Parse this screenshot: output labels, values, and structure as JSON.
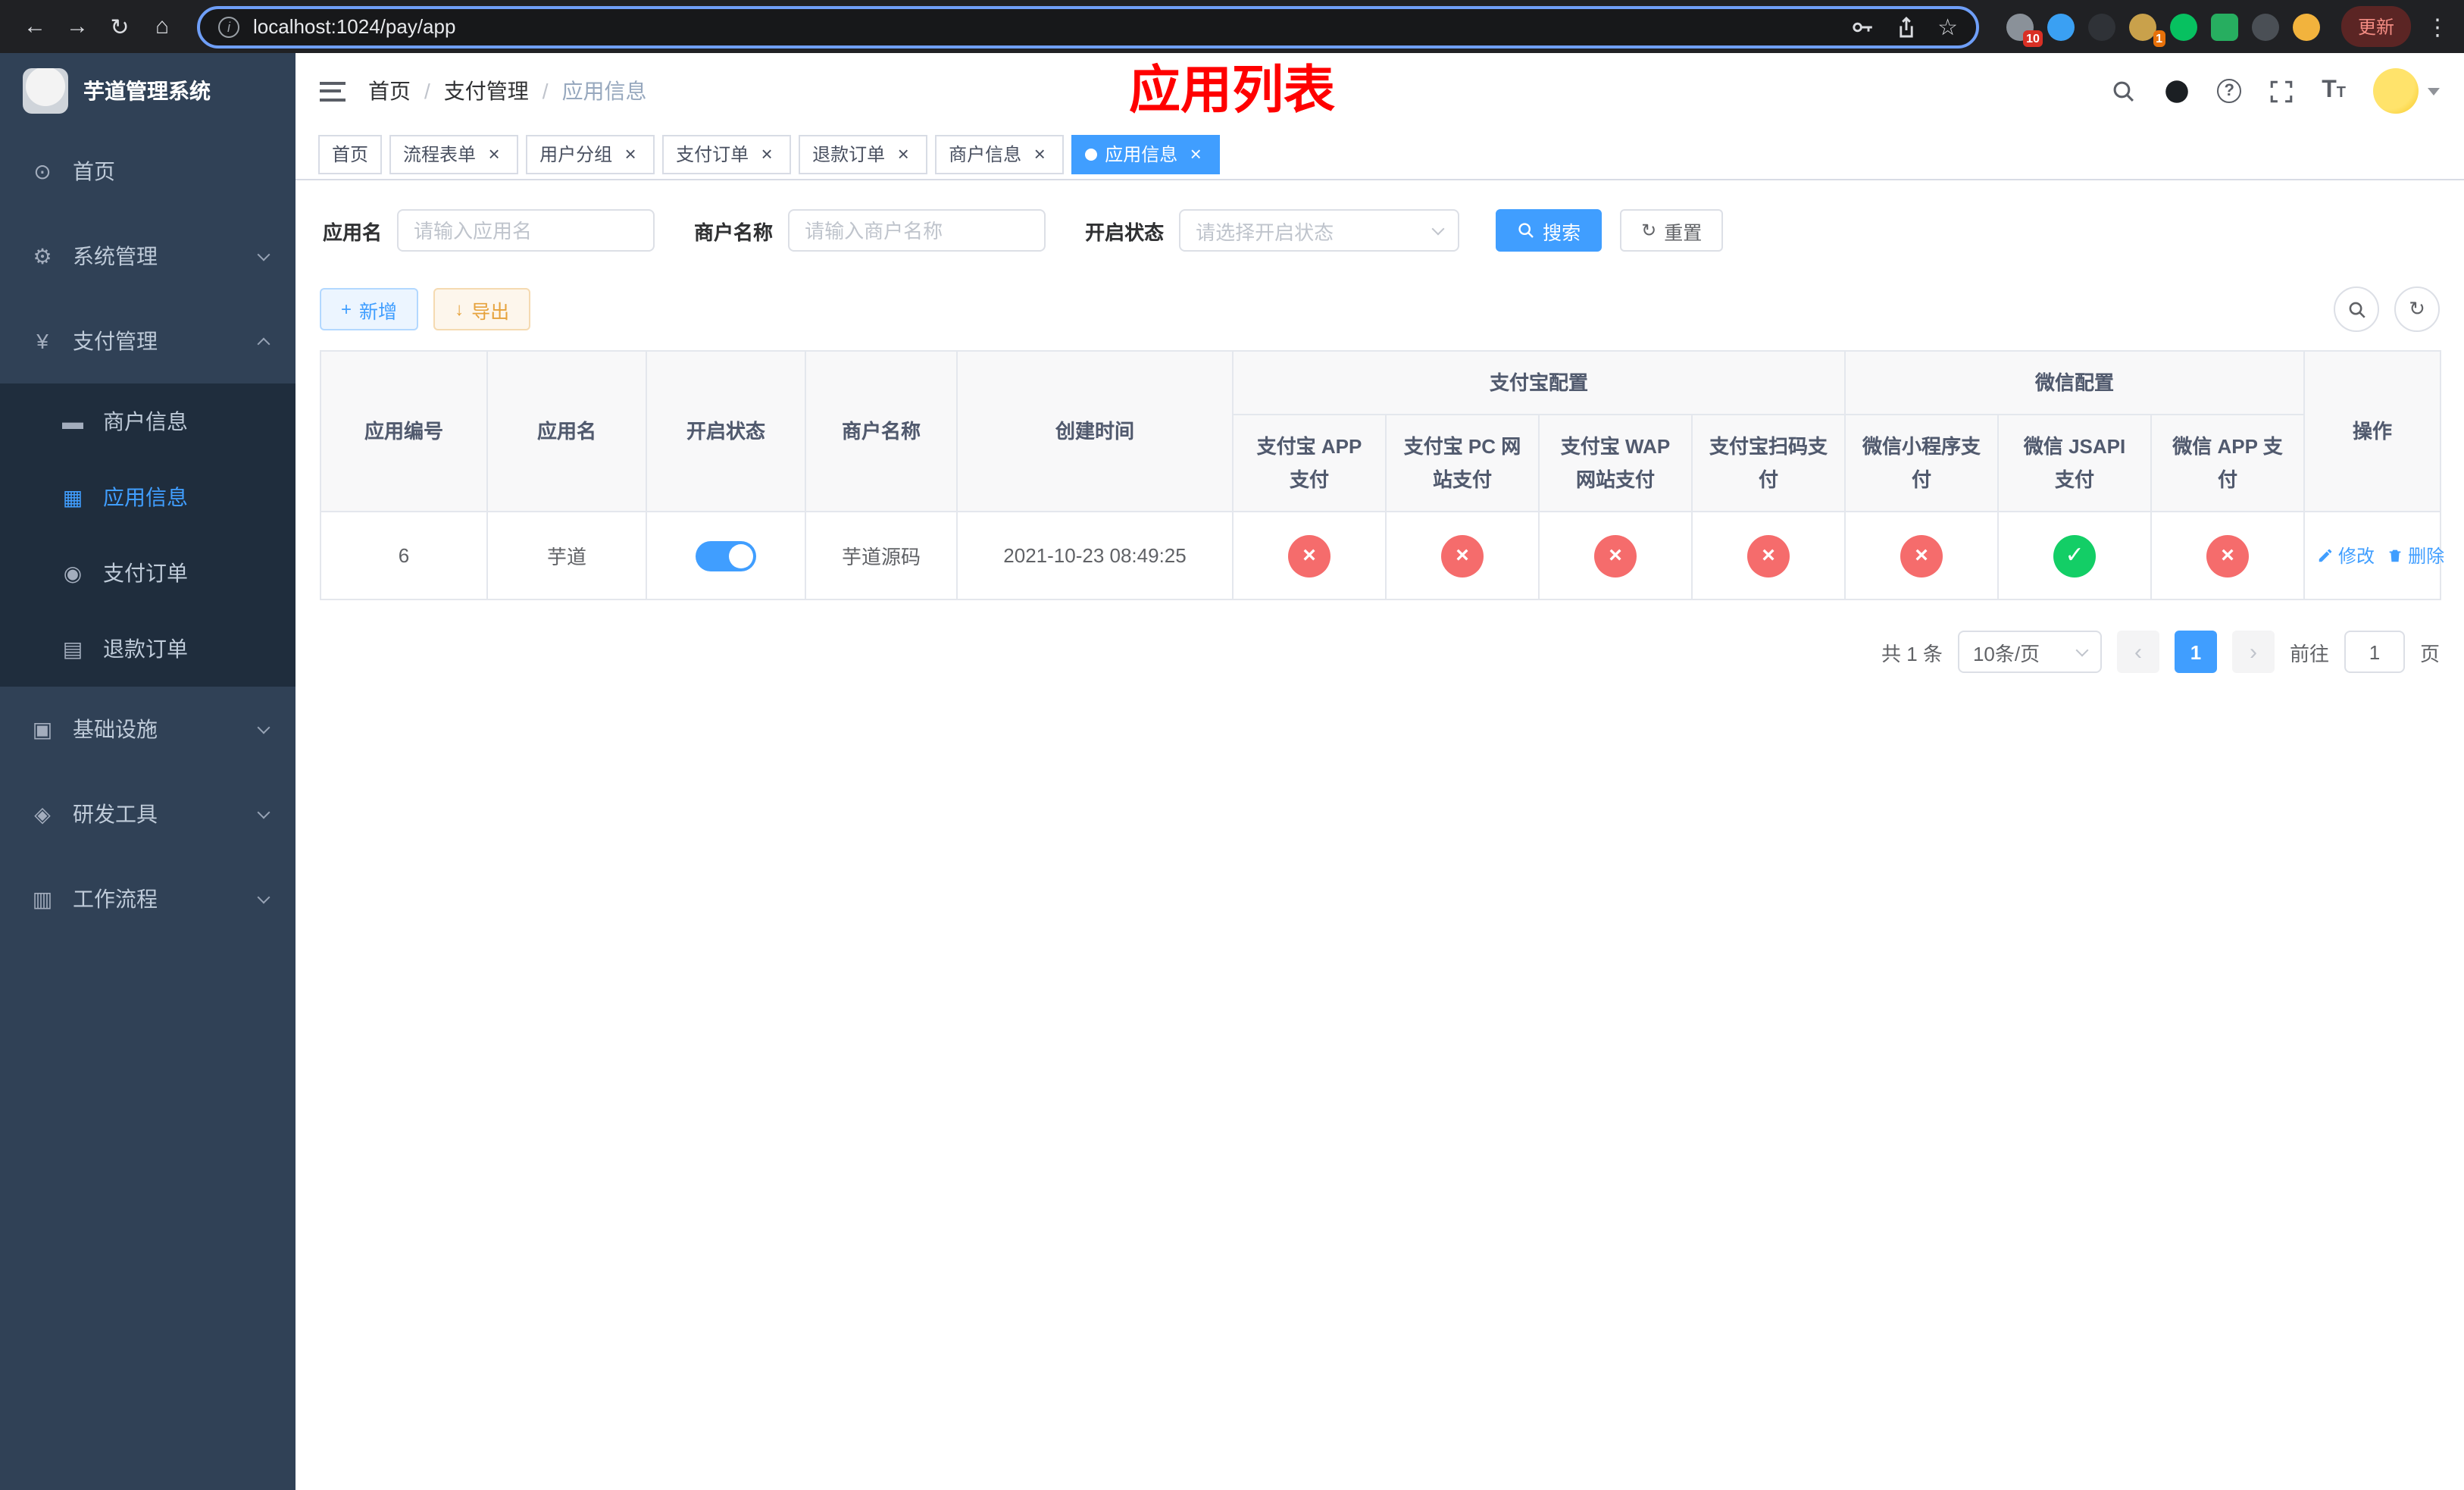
{
  "browser": {
    "url": "localhost:1024/pay/app",
    "update_label": "更新",
    "extensions": [
      {
        "name": "extension-icon-1",
        "color": "#8a9199",
        "badge": "10",
        "badge_color": "#d93025",
        "shape": "circle"
      },
      {
        "name": "extension-icon-2",
        "color": "#3aa0f3",
        "badge": "",
        "badge_color": "",
        "shape": "circle"
      },
      {
        "name": "extension-icon-3",
        "color": "#2f3237",
        "badge": "",
        "badge_color": "",
        "shape": "circle"
      },
      {
        "name": "extension-icon-4",
        "color": "#c9a14b",
        "badge": "1",
        "badge_color": "#e8710a",
        "shape": "circle"
      },
      {
        "name": "extension-icon-5",
        "color": "#07c160",
        "badge": "",
        "badge_color": "",
        "shape": "circle"
      },
      {
        "name": "extension-icon-6",
        "color": "#27ae60",
        "badge": "",
        "badge_color": "",
        "shape": "square"
      },
      {
        "name": "extension-icon-7",
        "color": "#4a4f55",
        "badge": "",
        "badge_color": "",
        "shape": "circle"
      },
      {
        "name": "extension-icon-8",
        "color": "#f2b33d",
        "badge": "",
        "badge_color": "",
        "shape": "circle"
      }
    ]
  },
  "sidebar": {
    "title": "芋道管理系统",
    "items": [
      {
        "key": "home",
        "label": "首页",
        "icon": "dashboard-icon",
        "glyph": "⊙",
        "submenu": false,
        "expanded": false
      },
      {
        "key": "system",
        "label": "系统管理",
        "icon": "gear-icon",
        "glyph": "⚙",
        "submenu": true,
        "expanded": false
      },
      {
        "key": "payment",
        "label": "支付管理",
        "icon": "yen-icon",
        "glyph": "¥",
        "submenu": true,
        "expanded": true,
        "children": [
          {
            "key": "merchant-info",
            "label": "商户信息",
            "icon": "merchant-card-icon",
            "glyph": "▬",
            "active": false
          },
          {
            "key": "app-info",
            "label": "应用信息",
            "icon": "app-grid-icon",
            "glyph": "▦",
            "active": true
          },
          {
            "key": "pay-order",
            "label": "支付订单",
            "icon": "pay-order-icon",
            "glyph": "◉",
            "active": false
          },
          {
            "key": "refund-order",
            "label": "退款订单",
            "icon": "refund-doc-icon",
            "glyph": "▤",
            "active": false
          }
        ]
      },
      {
        "key": "infrastructure",
        "label": "基础设施",
        "icon": "infra-icon",
        "glyph": "▣",
        "submenu": true,
        "expanded": false
      },
      {
        "key": "dev-tools",
        "label": "研发工具",
        "icon": "devtools-icon",
        "glyph": "◈",
        "submenu": true,
        "expanded": false
      },
      {
        "key": "workflow",
        "label": "工作流程",
        "icon": "workflow-icon",
        "glyph": "▥",
        "submenu": true,
        "expanded": false
      }
    ]
  },
  "header": {
    "breadcrumbs": [
      "首页",
      "支付管理",
      "应用信息"
    ],
    "separator": "/",
    "page_title": "应用列表"
  },
  "tabs": [
    {
      "key": "home",
      "label": "首页",
      "closable": false,
      "active": false
    },
    {
      "key": "process-form",
      "label": "流程表单",
      "closable": true,
      "active": false
    },
    {
      "key": "user-group",
      "label": "用户分组",
      "closable": true,
      "active": false
    },
    {
      "key": "pay-order",
      "label": "支付订单",
      "closable": true,
      "active": false
    },
    {
      "key": "refund-order",
      "label": "退款订单",
      "closable": true,
      "active": false
    },
    {
      "key": "merchant-info",
      "label": "商户信息",
      "closable": true,
      "active": false
    },
    {
      "key": "app-info",
      "label": "应用信息",
      "closable": true,
      "active": true
    }
  ],
  "filters": {
    "app_name_label": "应用名",
    "app_name_placeholder": "请输入应用名",
    "merchant_name_label": "商户名称",
    "merchant_name_placeholder": "请输入商户名称",
    "status_label": "开启状态",
    "status_placeholder": "请选择开启状态",
    "search_label": "搜索",
    "reset_label": "重置"
  },
  "toolbar": {
    "add_label": "新增",
    "export_label": "导出"
  },
  "table": {
    "plain_columns": [
      {
        "key": "app-id",
        "label": "应用编号"
      },
      {
        "key": "app-name",
        "label": "应用名"
      },
      {
        "key": "status",
        "label": "开启状态"
      },
      {
        "key": "merchant-name",
        "label": "商户名称"
      },
      {
        "key": "created-time",
        "label": "创建时间"
      }
    ],
    "groups": [
      {
        "key": "alipay",
        "label": "支付宝配置",
        "children": [
          {
            "key": "alipay-app-pay",
            "label": "支付宝 APP 支付"
          },
          {
            "key": "alipay-pc-pay",
            "label": "支付宝 PC 网站支付"
          },
          {
            "key": "alipay-wap-pay",
            "label": "支付宝 WAP 网站支付"
          },
          {
            "key": "alipay-qr-pay",
            "label": "支付宝扫码支付"
          }
        ]
      },
      {
        "key": "wechat",
        "label": "微信配置",
        "children": [
          {
            "key": "wechat-lite-pay",
            "label": "微信小程序支付"
          },
          {
            "key": "wechat-jsapi-pay",
            "label": "微信 JSAPI 支付"
          },
          {
            "key": "wechat-app-pay",
            "label": "微信 APP 支付"
          }
        ]
      }
    ],
    "action_column": "操作",
    "channel_keys": [
      "alipay-app-pay",
      "alipay-pc-pay",
      "alipay-wap-pay",
      "alipay-qr-pay",
      "wechat-lite-pay",
      "wechat-jsapi-pay",
      "wechat-app-pay"
    ],
    "rows": [
      {
        "id": "6",
        "name": "芋道",
        "enabled": true,
        "merchant": "芋道源码",
        "created": "2021-10-23 08:49:25",
        "channels": [
          false,
          false,
          false,
          false,
          false,
          true,
          false
        ],
        "edit_label": "修改",
        "delete_label": "删除"
      }
    ]
  },
  "pagination": {
    "total": "共 1 条",
    "page_size": "10条/页",
    "page": "1",
    "goto_label": "前往",
    "page_unit_label": "页"
  },
  "icons": {
    "back": "←",
    "forward": "→",
    "reload": "↻",
    "home": "⌂",
    "info": "i",
    "star": "☆",
    "more": "⋮",
    "close": "×",
    "plus": "+",
    "download": "↓",
    "refresh": "↻",
    "check": "✓",
    "cross": "×",
    "prev": "‹",
    "next": "›",
    "question": "?",
    "font_large": "T",
    "font_small": "T"
  },
  "colors": {
    "accent": "#409eff",
    "danger": "#f56c6c",
    "success": "#13ce66",
    "title_red": "#ff0000",
    "sidebar_bg": "#304156",
    "submenu_bg": "#1f2d3d"
  }
}
